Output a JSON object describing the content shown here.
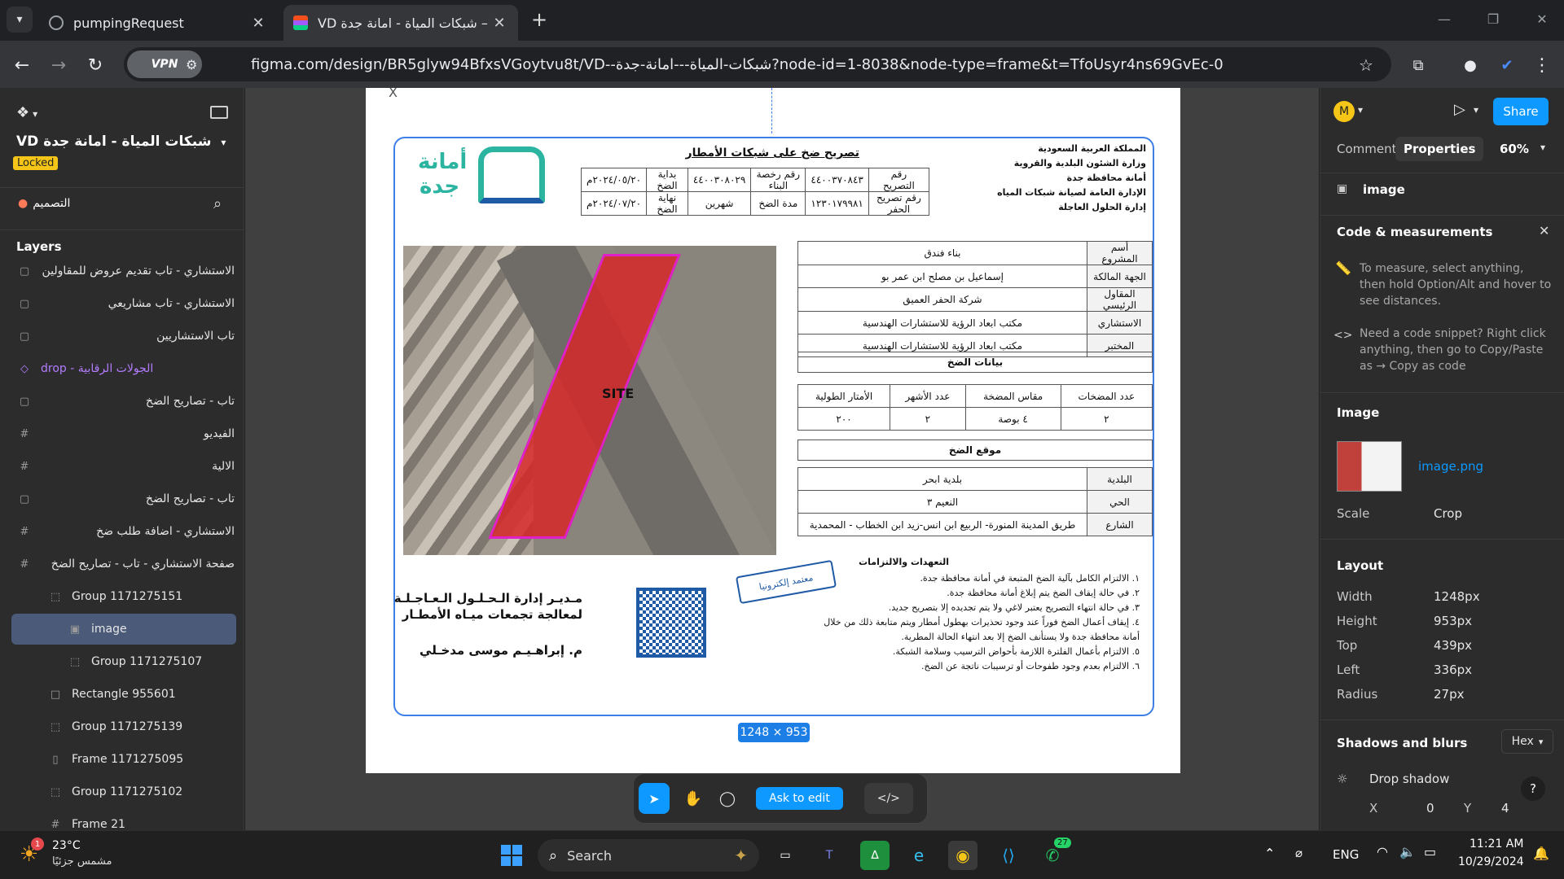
{
  "browser": {
    "tabs": [
      {
        "title": "pumpingRequest"
      },
      {
        "title": "VD شبكات المياة - امانة جدة – Fig"
      }
    ],
    "new_tab": "+",
    "vpn_label": "VPN",
    "url": "figma.com/design/BR5glyw94BfxsVGoytvu8t/VD--شبكات-المياة---امانة-جدة?node-id=1-8038&node-type=frame&t=TfoUsyr4ns69GvEc-0"
  },
  "figma_left": {
    "file_title": "VD شبكات المياة - امانة جدة",
    "locked_badge": "Locked",
    "page_label": "التصميم",
    "layers_title": "Layers",
    "layers": [
      {
        "label": "الاستشاري - تاب تقديم عروض للمقاولين",
        "icon": "frame-icon",
        "rtl": true
      },
      {
        "label": "الاستشاري - تاب مشاريعي",
        "icon": "frame-icon",
        "rtl": true
      },
      {
        "label": "تاب الاستشاريين",
        "icon": "frame-icon",
        "rtl": true
      },
      {
        "label": "drop - الجولات الرقابية",
        "icon": "component-icon",
        "rtl": false
      },
      {
        "label": "تاب - تصاريح الضخ",
        "icon": "frame-icon",
        "rtl": true
      },
      {
        "label": "الفيديو",
        "icon": "hash-icon",
        "rtl": true
      },
      {
        "label": "الالية",
        "icon": "hash-icon",
        "rtl": true
      },
      {
        "label": "تاب - تصاريح الضخ",
        "icon": "frame-icon",
        "rtl": true
      },
      {
        "label": "الاستشاري - اضافة طلب ضخ",
        "icon": "hash-icon",
        "rtl": true
      },
      {
        "label": "صفحة الاستشاري - تاب - تصاريح الضخ",
        "icon": "hash-icon",
        "rtl": true
      },
      {
        "label": "Group 1171275151",
        "icon": "group-icon",
        "rtl": false
      },
      {
        "label": "image",
        "icon": "image-icon",
        "rtl": false,
        "selected": true
      },
      {
        "label": "Group 1171275107",
        "icon": "group-icon",
        "rtl": false
      },
      {
        "label": "Rectangle 955601",
        "icon": "rect-icon",
        "rtl": false
      },
      {
        "label": "Group 1171275139",
        "icon": "group-icon",
        "rtl": false
      },
      {
        "label": "Frame 1171275095",
        "icon": "frame-bar-icon",
        "rtl": false
      },
      {
        "label": "Group 1171275102",
        "icon": "group-icon",
        "rtl": false
      },
      {
        "label": "Frame 21",
        "icon": "hash-icon",
        "rtl": false
      }
    ]
  },
  "document": {
    "close_mark": "X",
    "title": "تصريح ضخ على شبكات الأمطار",
    "header_lines": [
      "المملكة العربية السعودية",
      "وزارة الشئون البلدية والقروية",
      "أمانة محافظة جدة",
      "الإدارة العامة لصيانة شبكات المياه",
      "إدارة الحلول العاجلة"
    ],
    "logo_text_1": "أمانة",
    "logo_text_2": "جدة",
    "permit_table": [
      [
        "رقم التصريح",
        "٤٤٠٠٣٧٠٨٤٣",
        "رقم رخصة البناء",
        "٤٤٠٠٣٠٨٠٢٩",
        "بداية الضخ",
        "٢٠٢٤/٠٥/٢٠م"
      ],
      [
        "رقم تصريح الحفر",
        "١٢٣٠١٧٩٩٨١",
        "مدة الضخ",
        "شهرين",
        "نهاية الضخ",
        "٢٠٢٤/٠٧/٢٠م"
      ]
    ],
    "project_table": [
      [
        "أسم المشروع",
        "بناء فندق"
      ],
      [
        "الجهة المالكة",
        "إسماعيل بن مصلح ابن عمر بو"
      ],
      [
        "المقاول الرئيسي",
        "شركة الحفر العميق"
      ],
      [
        "الاستشاري",
        "مكتب ابعاد الرؤية للاستشارات الهندسية"
      ],
      [
        "المختبر",
        "مكتب ابعاد الرؤية للاستشارات الهندسية"
      ]
    ],
    "pump_title": "بيانات الضخ",
    "pump_headers": [
      "عدد المضخات",
      "مقاس المضخة",
      "عدد الأشهر",
      "الأمتار الطولية"
    ],
    "pump_values": [
      "٢",
      "٤ بوصة",
      "٢",
      "٢٠٠"
    ],
    "location_title": "موقع الضخ",
    "location_table": [
      [
        "البلدية",
        "بلدية ابحر"
      ],
      [
        "الحي",
        "النعيم ٣"
      ],
      [
        "الشارع",
        "طريق المدينة المنورة- الربيع ابن انس-زيد ابن الخطاب - المحمدية"
      ]
    ],
    "site_label": "SITE",
    "stamp_text": "معتمد إلكترونيا",
    "commitments_title": "التعهدات والالتزامات",
    "commitments": [
      "١.  الالتزام الكامل بآلية الضخ المتبعة في أمانة محافظة جدة.",
      "٢.  في حالة إيقاف الضخ يتم إبلاغ أمانة محافظة جدة.",
      "٣.  في حالة انتهاء التصريح يعتبر لاغي ولا يتم تجديده إلا بتصريح جديد.",
      "٤.  إيقاف أعمال الضخ فوراً عند وجود تحذيرات بهطول أمطار ويتم متابعة ذلك من خلال",
      "أمانة محافظة جدة ولا يستأنف الضخ إلا بعد انتهاء الحالة المطرية.",
      "٥.  الالتزام بأعمال الفلترة اللازمة بأحواض الترسيب وسلامة الشبكة.",
      "٦.  الالتزام بعدم وجود طفوحات أو ترسيبات ناتجة عن الضخ."
    ],
    "manager_line_1": "مـديـر إدارة الـحـلـول الـعـاجـلـة",
    "manager_line_2": "لمعالجة تجمعات ميـاه الأمطـار",
    "manager_name": "م. إبراهـيـم موسى مدخـلي",
    "size_badge": "1248 × 953"
  },
  "bottom_toolbar": {
    "ask_to_edit": "Ask to edit"
  },
  "figma_right": {
    "avatar_initial": "M",
    "share_label": "Share",
    "tab_comments": "Comments",
    "tab_properties": "Properties",
    "zoom": "60%",
    "selection_name": "image",
    "code_title": "Code & measurements",
    "code_tip_1": "To measure, select anything, then hold Option/Alt and hover to see distances.",
    "code_tip_2": "Need a code snippet? Right click anything, then go to Copy/Paste as → Copy as code",
    "image_title": "Image",
    "image_file": "image.png",
    "scale_label": "Scale",
    "scale_value": "Crop",
    "layout_title": "Layout",
    "layout": [
      {
        "k": "Width",
        "v": "1248px"
      },
      {
        "k": "Height",
        "v": "953px"
      },
      {
        "k": "Top",
        "v": "439px"
      },
      {
        "k": "Left",
        "v": "336px"
      },
      {
        "k": "Radius",
        "v": "27px"
      }
    ],
    "shadows_title": "Shadows and blurs",
    "hex_label": "Hex",
    "drop_shadow": "Drop shadow",
    "x_label": "X",
    "x_value": "0",
    "y_label": "Y",
    "y_value": "4",
    "help": "?"
  },
  "taskbar": {
    "temperature": "23°C",
    "weather": "مشمس جزئيًا",
    "weather_badge": "1",
    "search": "Search",
    "whatsapp_badge": "27",
    "language": "ENG",
    "time": "11:21 AM",
    "date": "10/29/2024"
  },
  "colors": {
    "figma_panel": "#2c2c2c",
    "accent_blue": "#0d99ff",
    "selection_blue": "#3d7fe6",
    "jeddah_teal": "#2bb4a0",
    "jeddah_blue": "#1f5aa6"
  }
}
